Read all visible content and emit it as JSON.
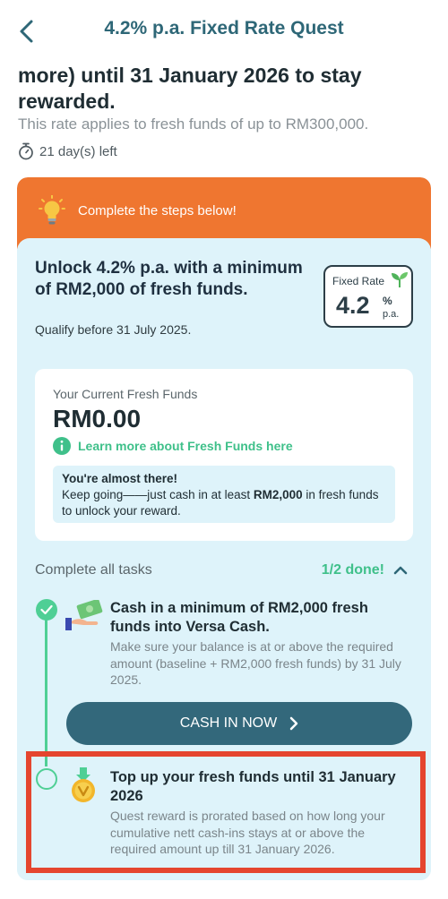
{
  "header": {
    "title": "4.2% p.a. Fixed Rate Quest",
    "back_icon": "chevron-left-icon"
  },
  "quest": {
    "title": "more) until 31 January 2026 to stay rewarded.",
    "subtitle": "This rate applies to fresh funds of up to RM300,000.",
    "days_left": "21 day(s) left",
    "timer_icon": "stopwatch-icon"
  },
  "banner": {
    "text": "Complete the steps below!",
    "icon": "lightbulb-icon",
    "color": "#ef7630"
  },
  "unlock": {
    "title": "Unlock 4.2% p.a. with a minimum of RM2,000 of fresh funds.",
    "qualify": "Qualify before 31 July 2025."
  },
  "rate_badge": {
    "label": "Fixed Rate",
    "value": "4.2",
    "percent": "%",
    "pa": "p.a.",
    "icon": "sprout-icon"
  },
  "funds": {
    "label": "Your Current Fresh Funds",
    "value": "RM0.00",
    "learn_more": "Learn more about Fresh Funds here",
    "almost_title": "You're almost there!",
    "almost_pre": "Keep going——just cash in at least ",
    "almost_amount": "RM2,000",
    "almost_post": " in fresh funds to unlock your reward."
  },
  "tasks": {
    "label": "Complete all tasks",
    "progress": "1/2 done!",
    "items": [
      {
        "title": "Cash in a minimum of RM2,000 fresh funds into Versa Cash.",
        "description": "Make sure your balance is at or above the required amount (baseline + RM2,000 fresh funds) by 31 July 2025.",
        "status": "completed",
        "icon": "cash-in-hand-icon",
        "button": "CASH IN NOW"
      },
      {
        "title": "Top up your fresh funds until 31 January 2026",
        "description": "Quest reward is prorated based on how long your cumulative nett cash-ins stays at or above the required amount up till 31 January 2026.",
        "status": "pending",
        "icon": "medal-icon"
      }
    ]
  },
  "colors": {
    "accent_green": "#4fcf95",
    "button_teal": "#33687b",
    "card_bg": "#def3fa",
    "highlight_red": "#e5452e"
  }
}
